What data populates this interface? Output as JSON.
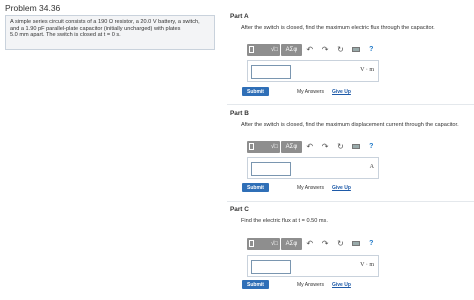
{
  "problem": {
    "title": "Problem 34.36",
    "text_line1": "A simple series circuit consists of a 190 Ω resistor, a 20.0 V battery, a switch,",
    "text_line2": "and a 1.90 pF parallel-plate capacitor (initially uncharged) with plates",
    "text_line3": "5.0 mm apart. The switch is closed at t = 0 s."
  },
  "toolbar": {
    "format_icon": "sqrt-template-icon",
    "greek_label": "ΑΣφ",
    "undo_icon": "undo-icon",
    "redo_icon": "redo-icon",
    "reset_icon": "reset-icon",
    "keyboard_icon": "keyboard-icon",
    "help_label": "?"
  },
  "parts": [
    {
      "label": "Part A",
      "question": "After the switch is closed, find the maximum electric flux through the capacitor.",
      "unit": "V · m",
      "submit": "Submit",
      "my_answers": "My Answers",
      "give_up": "Give Up"
    },
    {
      "label": "Part B",
      "question": "After the switch is closed, find the maximum displacement current through the capacitor.",
      "unit": "A",
      "submit": "Submit",
      "my_answers": "My Answers",
      "give_up": "Give Up"
    },
    {
      "label": "Part C",
      "question": "Find the electric flux at t = 0.50 ms.",
      "unit": "V · m",
      "submit": "Submit",
      "my_answers": "My Answers",
      "give_up": "Give Up"
    }
  ],
  "colors": {
    "submit_bg": "#2f6fb7",
    "link": "#1e5aa8",
    "toolbar_bg": "#8e8e8e",
    "problem_box_bg": "#f3f4f6"
  }
}
